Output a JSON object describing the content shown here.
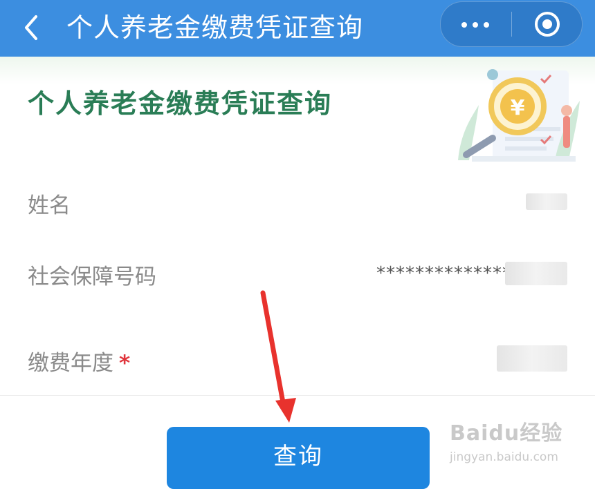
{
  "navbar": {
    "title": "个人养老金缴费凭证查询",
    "back_icon": "chevron-left-icon",
    "more_icon": "more-dots-icon",
    "close_icon": "target-close-icon",
    "bg_color": "#3c8ee0"
  },
  "banner": {
    "title": "个人养老金缴费凭证查询",
    "illustration": "magnifier-yuan-illustration",
    "title_color": "#2a7d56"
  },
  "form": {
    "rows": [
      {
        "label": "姓名",
        "value": ""
      },
      {
        "label": "社会保障号码",
        "value": "**************"
      },
      {
        "label": "缴费年度",
        "required_mark": "*",
        "value": ""
      }
    ]
  },
  "actions": {
    "query_label": "查询",
    "button_color": "#1e86e0"
  },
  "watermark": {
    "top_text": "Baidu经验",
    "bottom_text": "jingyan.baidu.com"
  },
  "annotation": {
    "arrow_color": "#e8322d"
  }
}
